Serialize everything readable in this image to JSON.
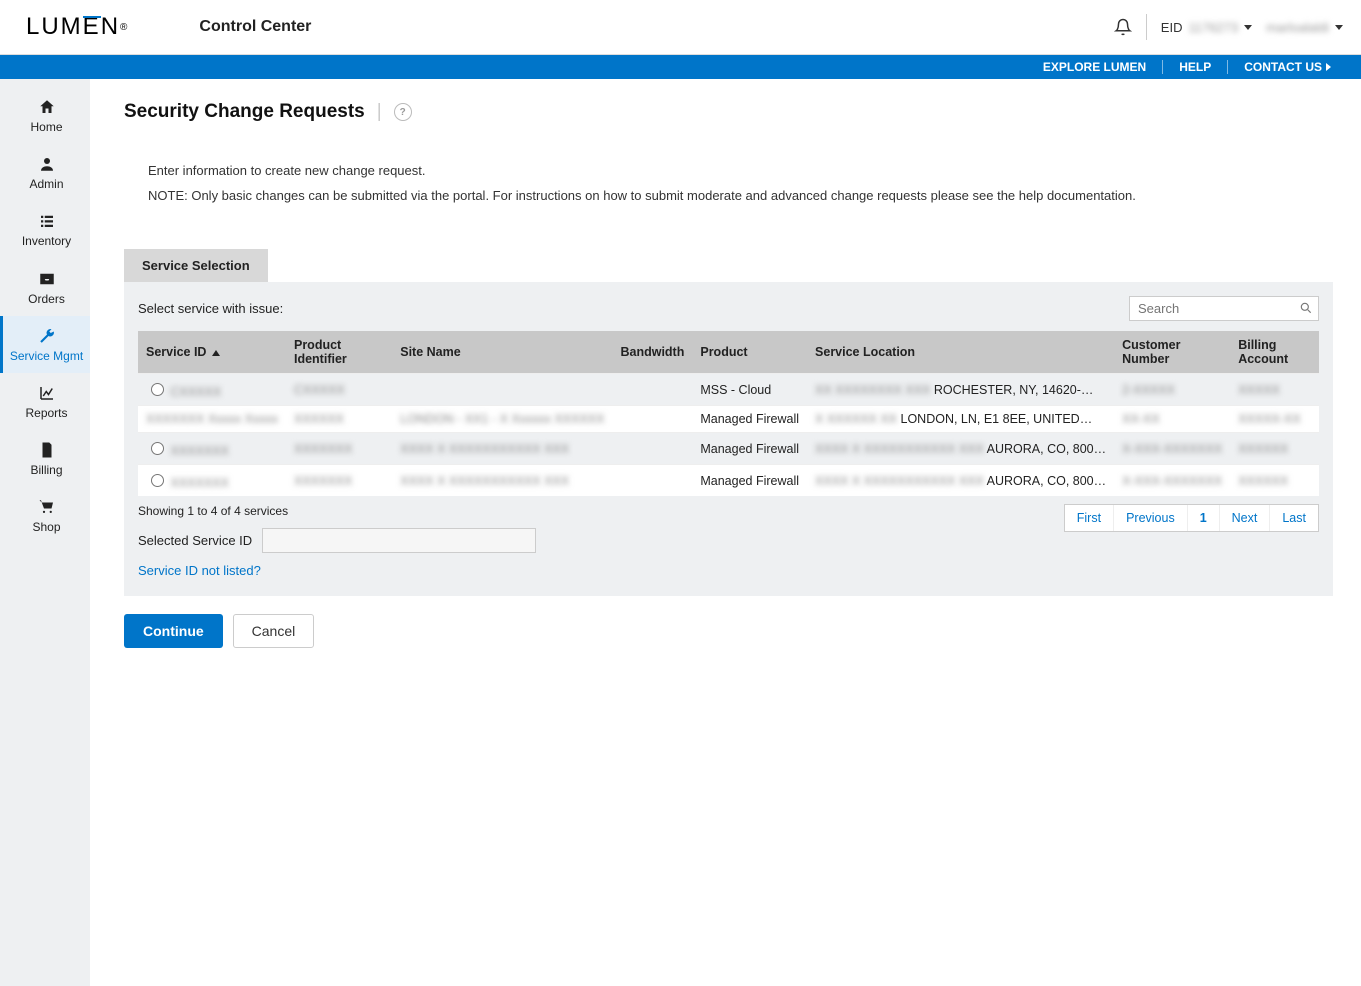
{
  "header": {
    "logo_text": "LUMEN",
    "product_title": "Control Center",
    "eid_label": "EID",
    "eid_value": "1176273",
    "username": "marloalaldi"
  },
  "bluebar": {
    "explore": "EXPLORE LUMEN",
    "help": "HELP",
    "contact": "CONTACT US"
  },
  "sidebar": {
    "items": [
      {
        "label": "Home"
      },
      {
        "label": "Admin"
      },
      {
        "label": "Inventory"
      },
      {
        "label": "Orders"
      },
      {
        "label": "Service Mgmt"
      },
      {
        "label": "Reports"
      },
      {
        "label": "Billing"
      },
      {
        "label": "Shop"
      }
    ],
    "active_index": 4
  },
  "page": {
    "title": "Security Change Requests",
    "intro_line1": "Enter information to create new change request.",
    "intro_line2": "NOTE: Only basic changes can be submitted via the portal. For instructions on how to submit moderate and advanced change requests please see the help documentation."
  },
  "panel": {
    "tab_label": "Service Selection",
    "select_label": "Select service with issue:",
    "search_placeholder": "Search",
    "columns": [
      "Service ID",
      "Product Identifier",
      "Site Name",
      "Bandwidth",
      "Product",
      "Service Location",
      "Customer Number",
      "Billing Account"
    ],
    "sorted_column": "Service ID",
    "rows": [
      {
        "has_radio": true,
        "service_id": "CXXXXX",
        "service_id_link": true,
        "product_identifier": "CXXXXX",
        "site_name": "",
        "bandwidth": "",
        "product": "MSS - Cloud",
        "service_location_prefix": "XX XXXXXXXX XXX",
        "service_location": "ROCHESTER, NY, 14620-…",
        "customer_number": "2-XXXXX",
        "billing_account": "XXXXX"
      },
      {
        "has_radio": false,
        "service_id": "XXXXXXX Xxxxx Xxxxx",
        "service_id_link": true,
        "product_identifier": "XXXXXX",
        "site_name": "LONDON - XX1 - X Xxxxxx XXXXXX",
        "bandwidth": "",
        "product": "Managed Firewall",
        "service_location_prefix": "X XXXXXX XX",
        "service_location": "LONDON, LN, E1 8EE, UNITED…",
        "customer_number": "XX-XX",
        "billing_account": "XXXXX-XX"
      },
      {
        "has_radio": true,
        "service_id": "XXXXXXX",
        "service_id_link": true,
        "product_identifier": "XXXXXXX",
        "site_name": "XXXX X XXXXXXXXXXX XXX",
        "bandwidth": "",
        "product": "Managed Firewall",
        "service_location_prefix": "XXXX X XXXXXXXXXXX XXX",
        "service_location": "AURORA, CO, 800…",
        "customer_number": "X-XXX-XXXXXXX",
        "billing_account": "XXXXXX"
      },
      {
        "has_radio": true,
        "service_id": "XXXXXXX",
        "service_id_link": true,
        "product_identifier": "XXXXXXX",
        "site_name": "XXXX X XXXXXXXXXXX XXX",
        "bandwidth": "",
        "product": "Managed Firewall",
        "service_location_prefix": "XXXX X XXXXXXXXXXX XXX",
        "service_location": "AURORA, CO, 800…",
        "customer_number": "X-XXX-XXXXXXX",
        "billing_account": "XXXXXX"
      }
    ],
    "showing_text": "Showing 1 to 4 of 4 services",
    "pager": {
      "first": "First",
      "previous": "Previous",
      "page": "1",
      "next": "Next",
      "last": "Last"
    },
    "selected_label": "Selected Service ID",
    "selected_value": "",
    "not_listed": "Service ID not listed?"
  },
  "actions": {
    "continue": "Continue",
    "cancel": "Cancel"
  }
}
